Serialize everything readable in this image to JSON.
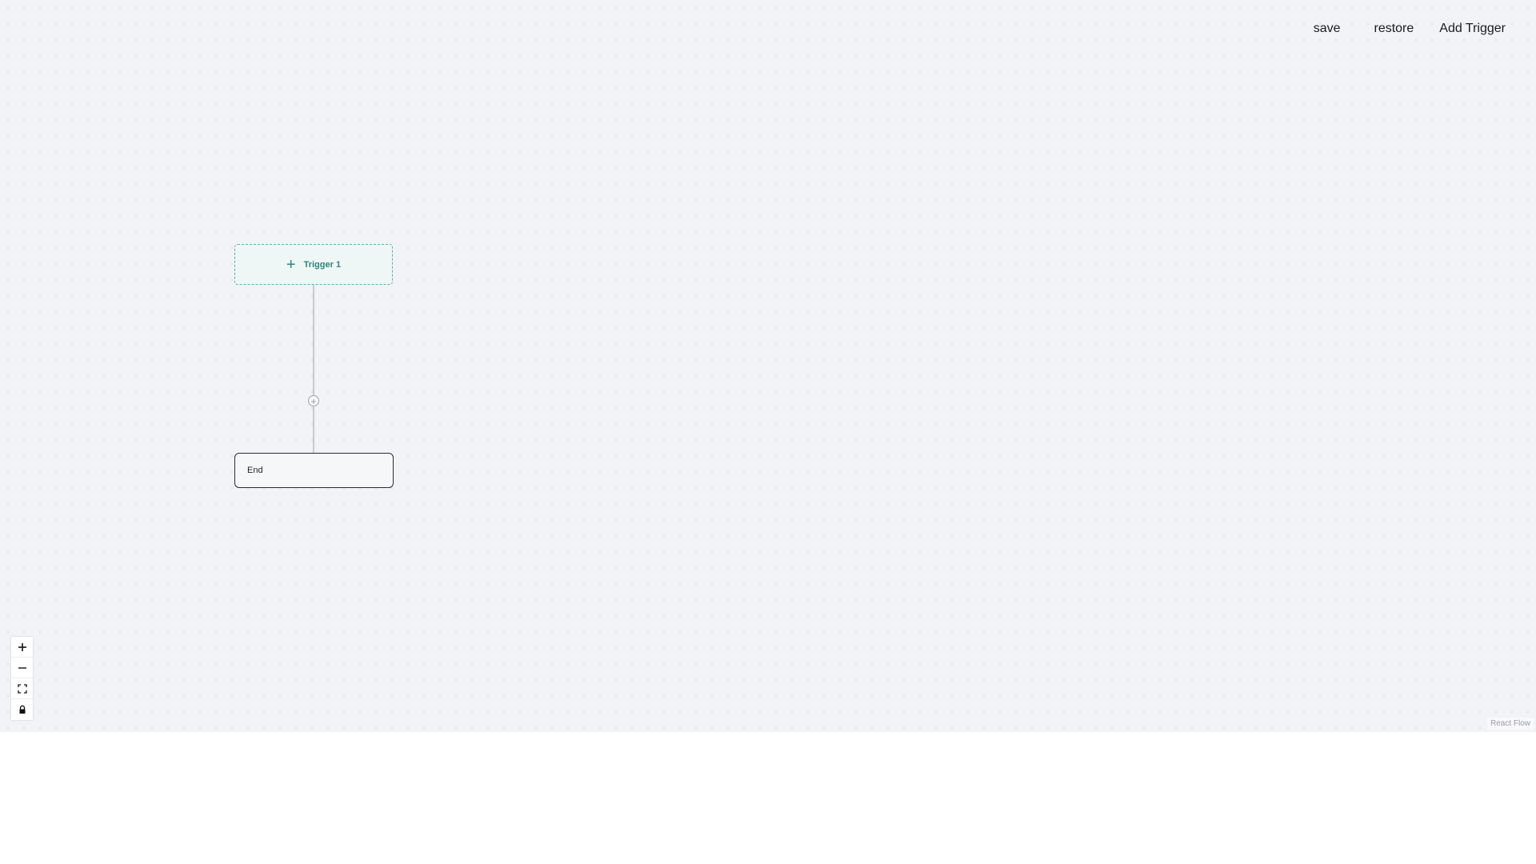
{
  "toolbar": {
    "save_label": "save",
    "restore_label": "restore",
    "add_trigger_label": "Add Trigger"
  },
  "nodes": {
    "trigger": {
      "icon": "plus-icon",
      "label": "Trigger 1"
    },
    "end": {
      "label": "End"
    }
  },
  "edge": {
    "add_icon": "plus-circle-icon"
  },
  "controls": {
    "zoom_in_icon": "plus-icon",
    "zoom_out_icon": "minus-icon",
    "fit_view_icon": "fit-view-icon",
    "lock_icon": "lock-icon"
  },
  "attribution": "React Flow",
  "colors": {
    "canvas_bg": "#f2f3f6",
    "trigger_accent": "#2a877d",
    "trigger_bg": "#eef7f6",
    "edge": "#9ca0a8"
  }
}
